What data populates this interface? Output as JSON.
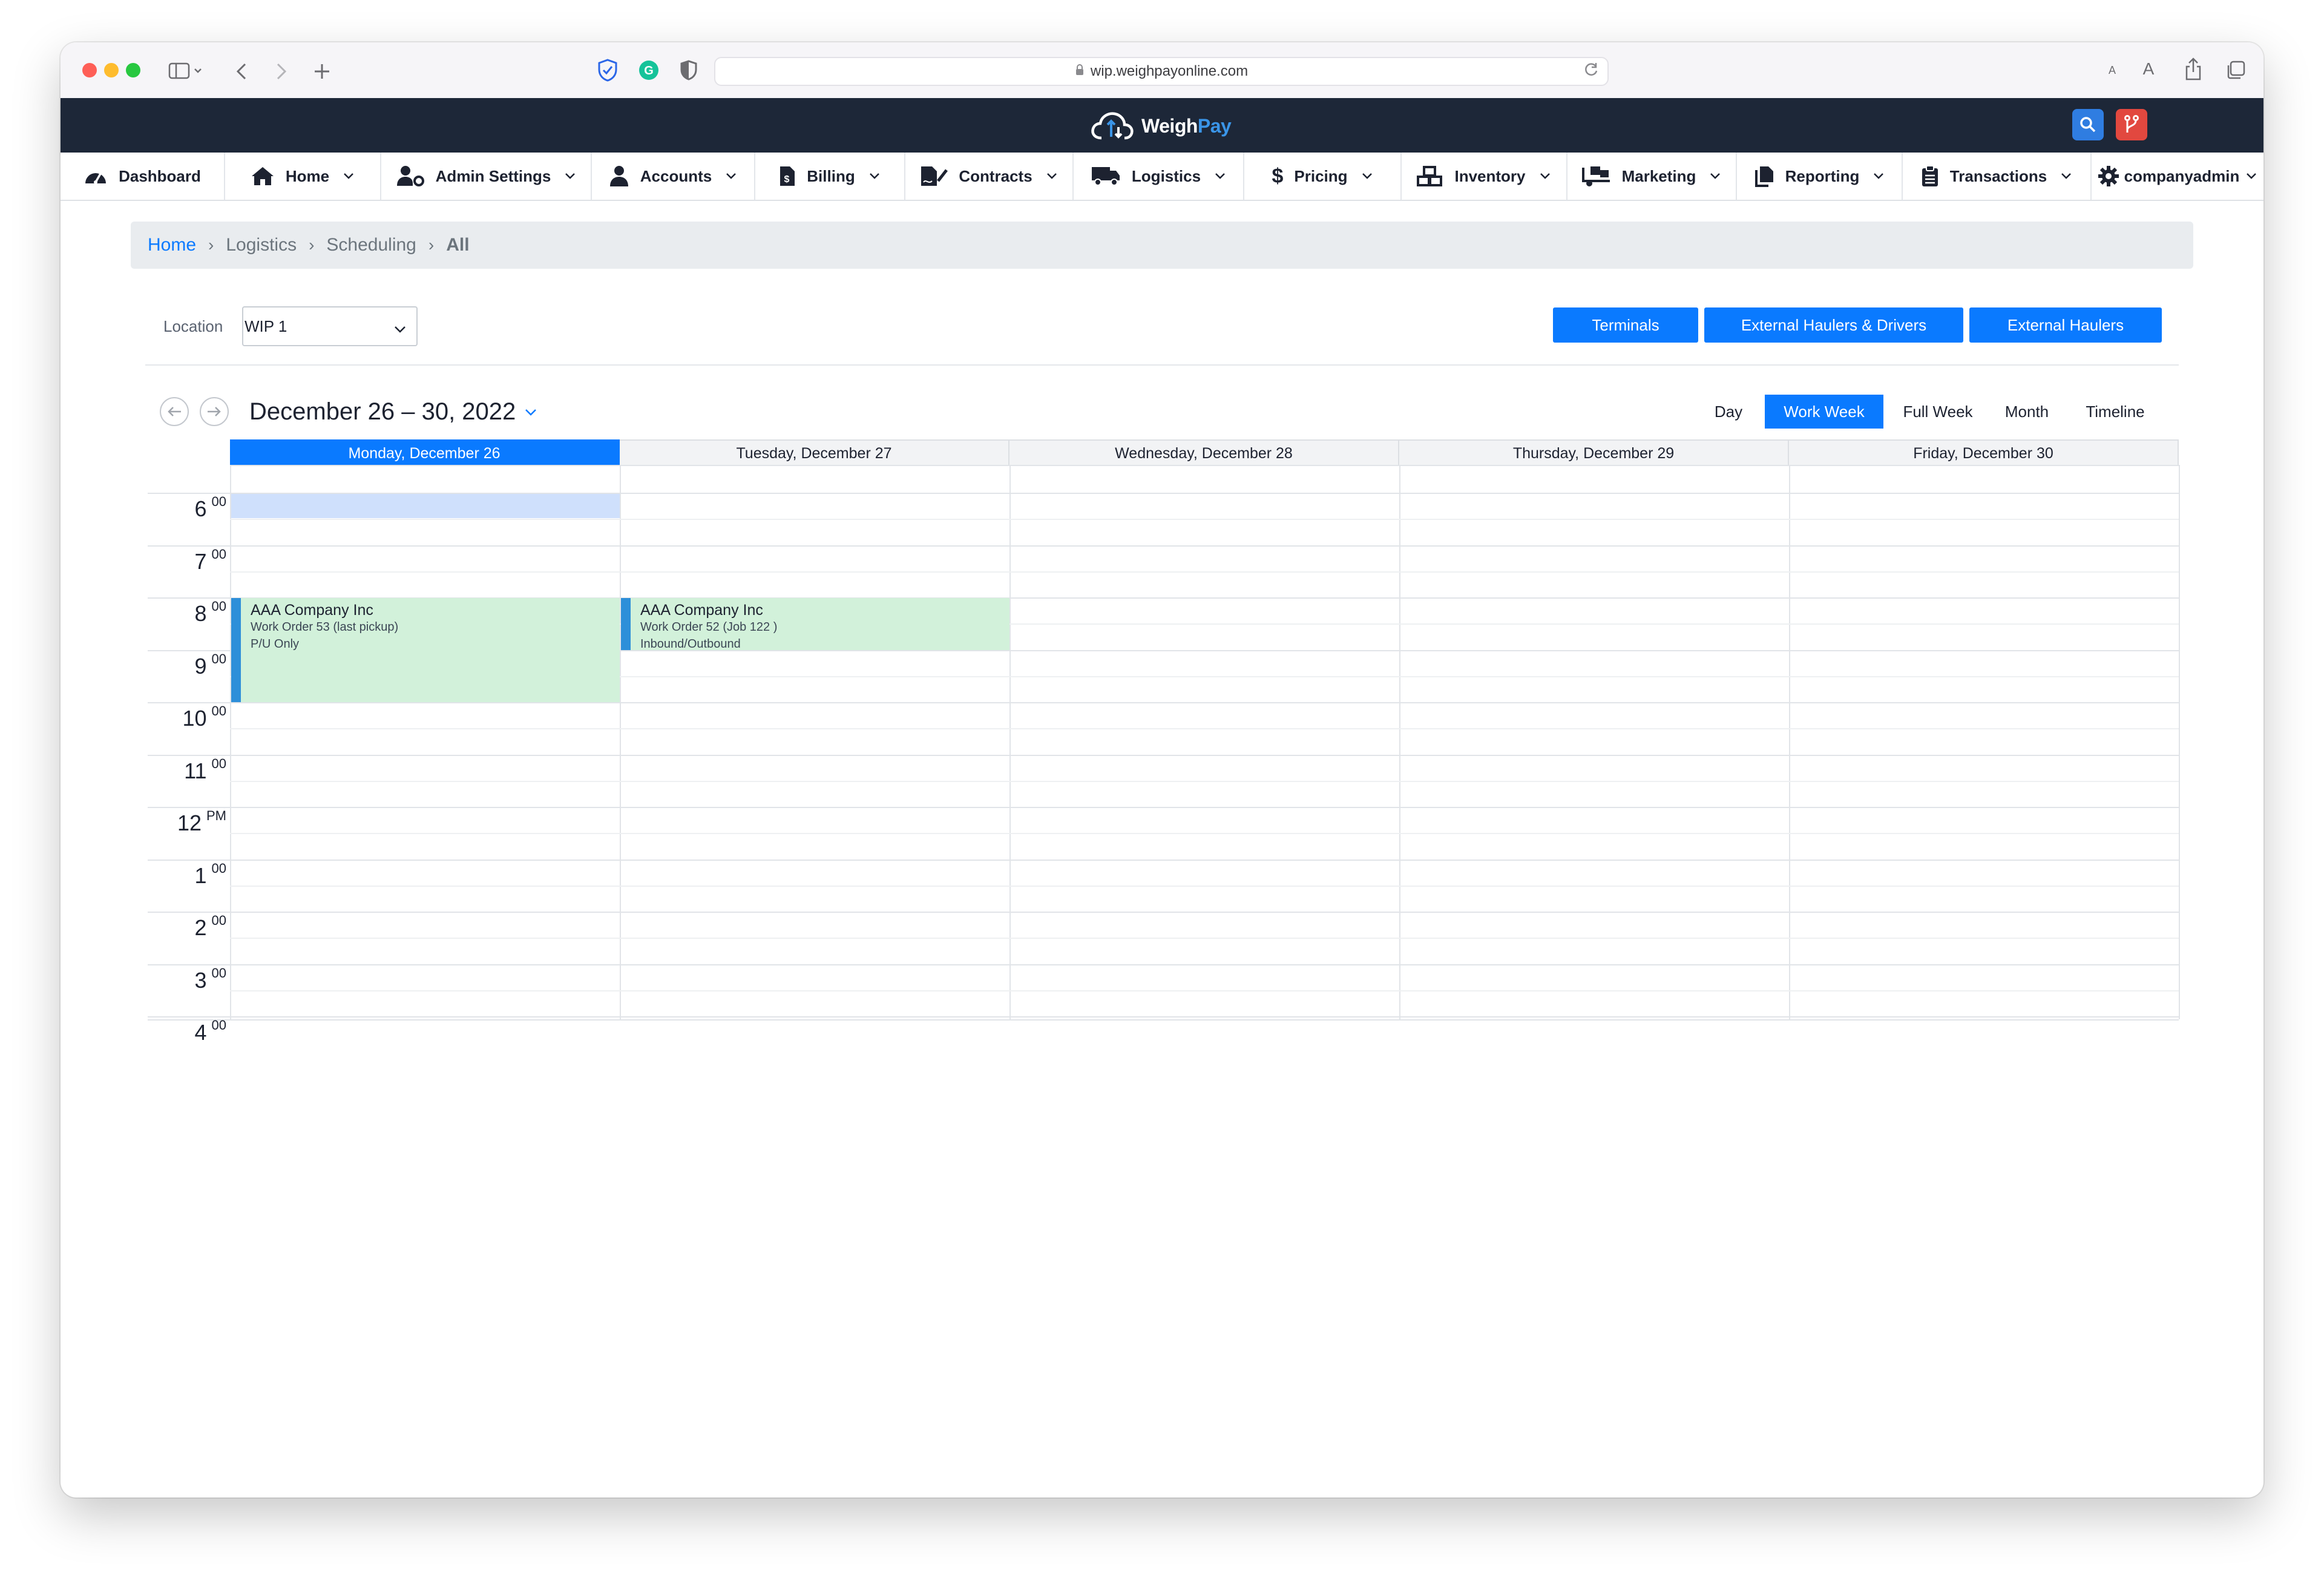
{
  "browser": {
    "url": "wip.weighpayonline.com",
    "reader_small": "A",
    "reader_large": "A"
  },
  "app": {
    "logo_main": "Weigh",
    "logo_accent": "Pay",
    "colors": {
      "header_bg": "#1d2738",
      "accent": "#0a7aff",
      "search_btn": "#2f7de1",
      "branch_btn": "#e2483f",
      "event_bg": "#d2f1da",
      "event_bar": "#2d8fd9"
    }
  },
  "nav": [
    {
      "label": "Dashboard",
      "icon": "gauge-icon"
    },
    {
      "label": "Home",
      "icon": "house-icon"
    },
    {
      "label": "Admin Settings",
      "icon": "user-gear-icon"
    },
    {
      "label": "Accounts",
      "icon": "user-icon"
    },
    {
      "label": "Billing",
      "icon": "invoice-icon"
    },
    {
      "label": "Contracts",
      "icon": "file-signature-icon"
    },
    {
      "label": "Logistics",
      "icon": "truck-icon"
    },
    {
      "label": "Pricing",
      "icon": "dollar-icon"
    },
    {
      "label": "Inventory",
      "icon": "boxes-icon"
    },
    {
      "label": "Marketing",
      "icon": "truck-loading-icon"
    },
    {
      "label": "Reporting",
      "icon": "copy-icon"
    },
    {
      "label": "Transactions",
      "icon": "clipboard-icon"
    },
    {
      "label": "companyadmin",
      "icon": "gear-icon"
    }
  ],
  "breadcrumb": [
    "Home",
    "Logistics",
    "Scheduling",
    "All"
  ],
  "location": {
    "label": "Location",
    "value": "WIP 1"
  },
  "buttons": {
    "terminals": "Terminals",
    "ext_haulers_drivers": "External Haulers & Drivers",
    "ext_haulers": "External Haulers"
  },
  "calendar": {
    "range": "December 26 – 30, 2022",
    "views": [
      "Day",
      "Work Week",
      "Full Week",
      "Month",
      "Timeline"
    ],
    "active_view": "Work Week",
    "days": [
      "Monday, December 26",
      "Tuesday, December 27",
      "Wednesday, December 28",
      "Thursday, December 29",
      "Friday, December 30"
    ],
    "selected_day": "Monday, December 26",
    "hours": [
      {
        "h": "6",
        "m": "00"
      },
      {
        "h": "7",
        "m": "00"
      },
      {
        "h": "8",
        "m": "00"
      },
      {
        "h": "9",
        "m": "00"
      },
      {
        "h": "10",
        "m": "00"
      },
      {
        "h": "11",
        "m": "00"
      },
      {
        "h": "12",
        "m": "PM"
      },
      {
        "h": "1",
        "m": "00"
      },
      {
        "h": "2",
        "m": "00"
      },
      {
        "h": "3",
        "m": "00"
      },
      {
        "h": "4",
        "m": "00"
      }
    ],
    "events": [
      {
        "day": "Monday, December 26",
        "start": "8:00",
        "end": "10:00",
        "title": "AAA Company Inc",
        "line2": "Work Order 53 (last pickup)",
        "line3": "P/U Only"
      },
      {
        "day": "Tuesday, December 27",
        "start": "8:00",
        "end": "9:00",
        "title": "AAA Company Inc",
        "line2": "Work Order 52 (Job 122 )",
        "line3": "Inbound/Outbound"
      }
    ]
  }
}
